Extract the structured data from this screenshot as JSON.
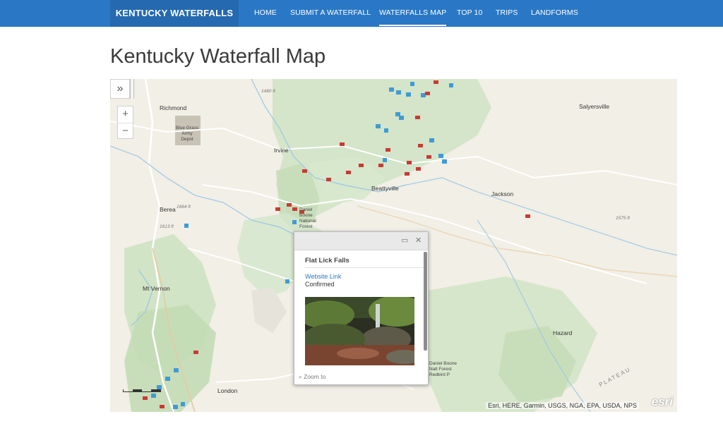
{
  "nav": {
    "brand": "KENTUCKY WATERFALLS",
    "items": [
      {
        "label": "HOME",
        "active": false
      },
      {
        "label": "SUBMIT A WATERFALL",
        "active": false
      },
      {
        "label": "WATERFALLS MAP",
        "active": true
      },
      {
        "label": "TOP 10",
        "active": false
      },
      {
        "label": "TRIPS",
        "active": false
      },
      {
        "label": "LANDFORMS",
        "active": false
      }
    ]
  },
  "page": {
    "title": "Kentucky Waterfall Map"
  },
  "map": {
    "expand_icon": "»",
    "zoom_in": "+",
    "zoom_out": "−",
    "attribution": "Esri, HERE, Garmin, USGS, NGA, EPA, USDA, NPS",
    "logo": "esri",
    "places": {
      "richmond": "Richmond",
      "depot": "Blue Grass Army Depot",
      "irvine": "Irvine",
      "berea": "Berea",
      "beattyville": "Beattyville",
      "salyersville": "Salyersville",
      "jackson": "Jackson",
      "mt_vernon": "Mt Vernon",
      "london": "London",
      "hazard": "Hazard",
      "dbnf_top": "Daniel Boone National Forest",
      "dbnf_bottom": "Daniel Boone Natl Forest Redbird P",
      "plateau": "PLATEAU"
    },
    "elevations": {
      "e1": "1480 ft",
      "e2": "1664 ft",
      "e3": "1613 ft",
      "e4": "1575 ft"
    },
    "colors": {
      "confirmed_marker": "#c93a35",
      "unconfirmed_marker": "#3f9bd6"
    }
  },
  "popup": {
    "title": "Flat Lick Falls",
    "link": "Website Link",
    "status": "Confirmed",
    "zoom_label": "Zoom to",
    "maximize_icon": "▭",
    "close_icon": "✕",
    "zoom_icon": "⌕"
  }
}
